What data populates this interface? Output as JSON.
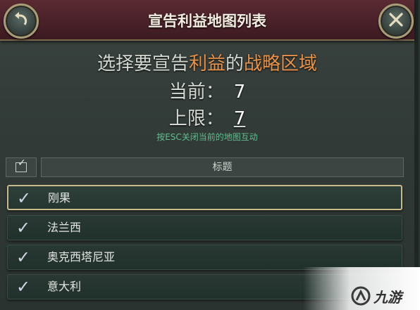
{
  "window": {
    "title": "宣告利益地图列表",
    "back_icon": "back-arrow-icon",
    "close_icon": "close-x-icon"
  },
  "header": {
    "headline_pre": "选择要宣告",
    "headline_hl1": "利益",
    "headline_mid": "的",
    "headline_hl2": "战略区域",
    "current_label": "当前：",
    "current_value": "7",
    "limit_label": "上限：",
    "limit_value": "7",
    "hint": "按ESC关闭当前的地图互动"
  },
  "table": {
    "column_title": "标题",
    "rows": [
      {
        "label": "刚果",
        "checked": true,
        "selected": true
      },
      {
        "label": "法兰西",
        "checked": true,
        "selected": false
      },
      {
        "label": "奥克西塔尼亚",
        "checked": true,
        "selected": false
      },
      {
        "label": "意大利",
        "checked": true,
        "selected": false
      }
    ]
  },
  "watermark": {
    "text": "九游"
  },
  "colors": {
    "titlebar": "#4a2129",
    "highlight": "#e9924a",
    "hint": "#5fbf8f",
    "selected_border": "#c8b88a"
  }
}
